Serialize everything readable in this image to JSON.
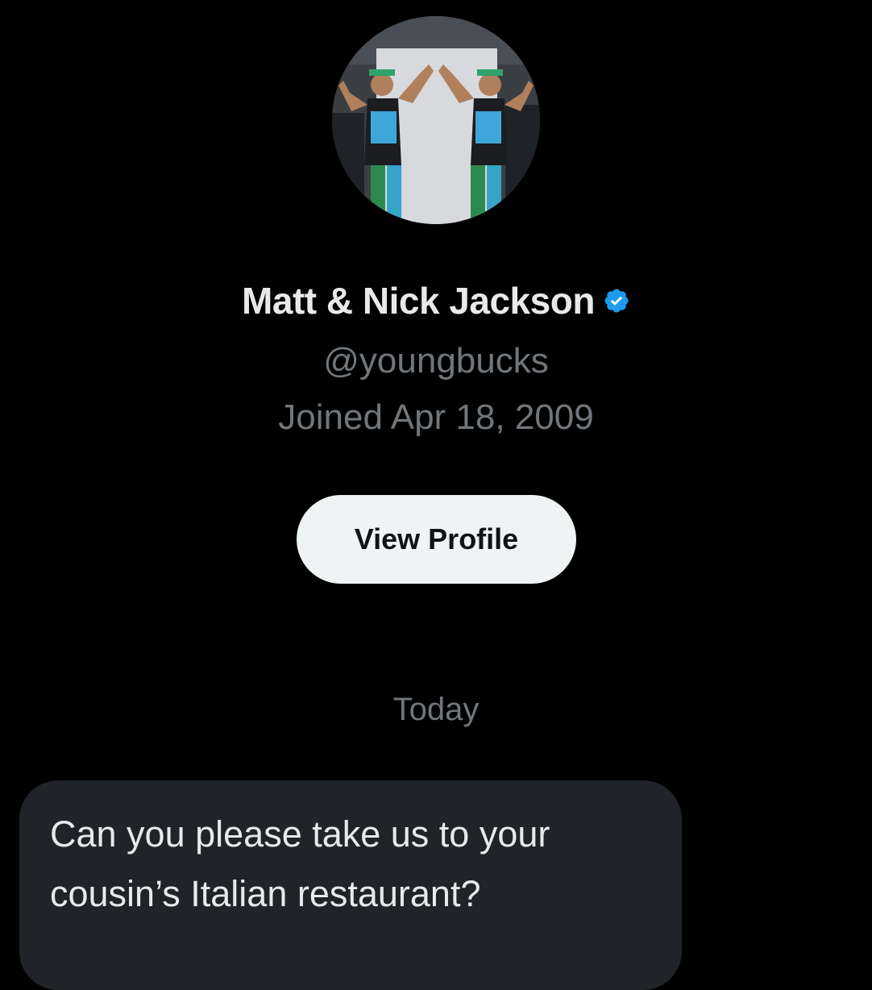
{
  "profile": {
    "display_name": "Matt & Nick Jackson",
    "handle": "@youngbucks",
    "joined": "Joined Apr 18, 2009",
    "verified_icon": "verified-badge-icon",
    "verified_color": "#1d9bf0"
  },
  "actions": {
    "view_profile_label": "View Profile"
  },
  "conversation": {
    "date_separator": "Today",
    "messages": [
      {
        "text": "Can you please take us to your\ncousin’s Italian restaurant?"
      }
    ]
  },
  "colors": {
    "background": "#000000",
    "primary_text": "#e7e9ea",
    "secondary_text": "#71767b",
    "button_bg": "#eff3f4",
    "bubble_bg": "#202327"
  }
}
